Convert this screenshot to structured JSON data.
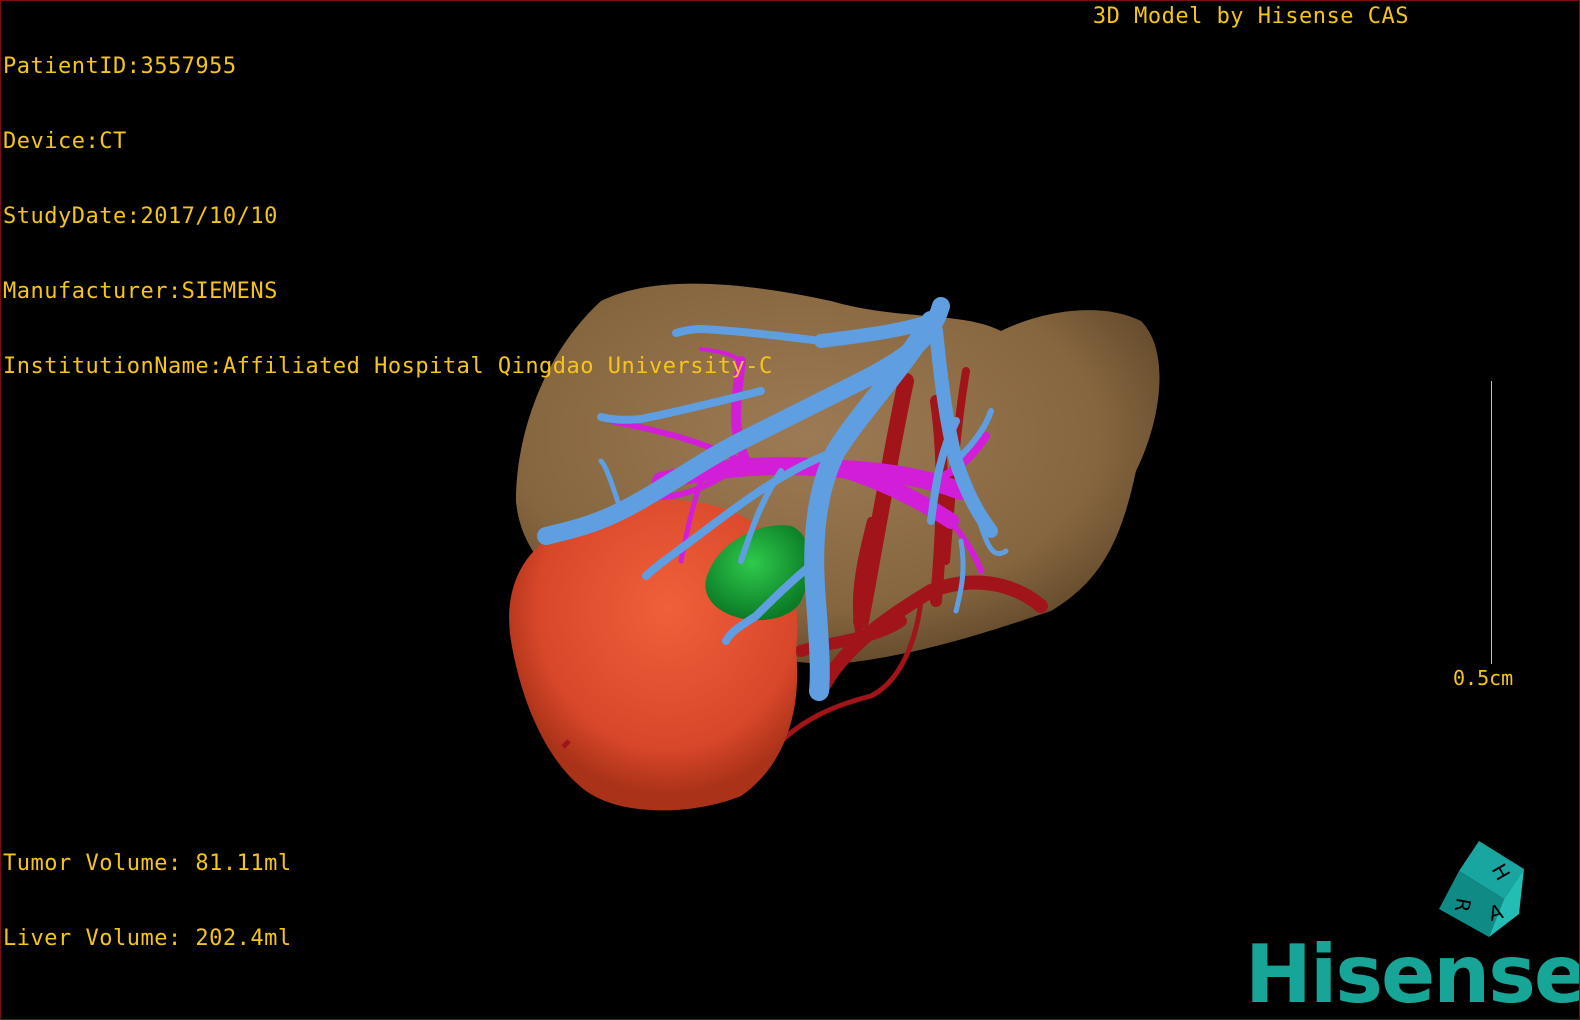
{
  "patient_info": {
    "patient_id": "PatientID:3557955",
    "device": "Device:CT",
    "study_date": "StudyDate:2017/10/10",
    "manufacturer": "Manufacturer:SIEMENS",
    "institution": "InstitutionName:Affiliated Hospital Qingdao University-C"
  },
  "credit": "3D Model by Hisense CAS",
  "volumes": {
    "tumor": "Tumor Volume: 81.11ml",
    "liver": "Liver Volume: 202.4ml"
  },
  "scale": {
    "label": "0.5cm"
  },
  "orientation_cube": {
    "labels": [
      "H",
      "R",
      "A"
    ]
  },
  "brand": {
    "logo_text": "Hisense",
    "color": "#16a596"
  },
  "colors": {
    "overlay_text": "#f5c518",
    "liver": "#8a6a48",
    "tumor": "#e2502e",
    "gallbladder": "#1aa63c",
    "hepatic_vein": "#5f9ee0",
    "portal_vein": "#d21ed8",
    "artery": "#a0141a"
  },
  "icons": [
    "orientation-cube-icon",
    "hisense-logo-icon"
  ]
}
